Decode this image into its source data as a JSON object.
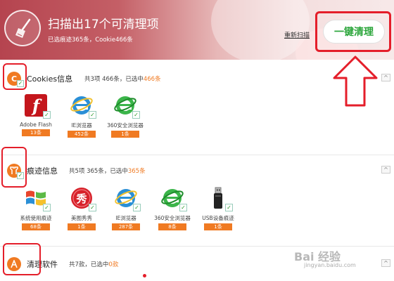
{
  "header": {
    "title": "扫描出17个可清理项",
    "subtitle": "已选痕迹365条，Cookie466条",
    "rescan_label": "重新扫描",
    "clean_label": "一键清理"
  },
  "sections": {
    "cookies": {
      "icon_glyph": "C",
      "title": "Cookies信息",
      "summary_prefix": "共3项 466条，已选中",
      "summary_highlight": "466条",
      "apps": [
        {
          "name": "Adobe Flash",
          "count": "13条"
        },
        {
          "name": "IE浏览器",
          "count": "452条"
        },
        {
          "name": "360安全浏览器",
          "count": "1条"
        }
      ]
    },
    "traces": {
      "title": "痕迹信息",
      "summary_prefix": "共5项 365条，已选中",
      "summary_highlight": "365条",
      "apps": [
        {
          "name": "系统使用痕迹",
          "count": "68条"
        },
        {
          "name": "美图秀秀",
          "count": "1条"
        },
        {
          "name": "IE浏览器",
          "count": "287条"
        },
        {
          "name": "360安全浏览器",
          "count": "8条"
        },
        {
          "name": "USB设备痕迹",
          "count": "1条"
        }
      ]
    },
    "software": {
      "title": "清理软件",
      "summary_prefix": "共7款，已选中",
      "summary_highlight": "0款"
    }
  },
  "collapse_glyph": "^",
  "check_glyph": "✓",
  "meitu_glyph": "秀",
  "watermark": {
    "main": "Bai 经验",
    "sub": "jingyan.baidu.com"
  },
  "colors": {
    "accent_orange": "#f07a22",
    "annotation_red": "#e41e2a",
    "clean_green": "#2aa53a"
  }
}
